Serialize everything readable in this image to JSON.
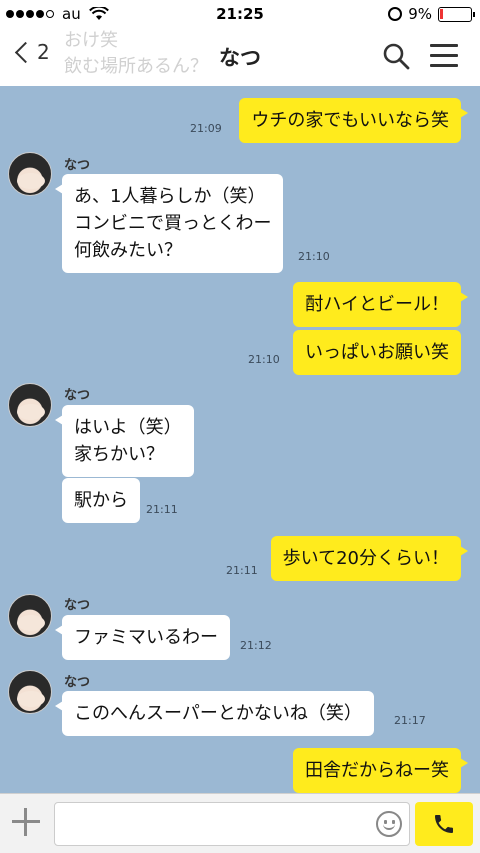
{
  "status_bar": {
    "carrier": "au",
    "time": "21:25",
    "battery": "9%",
    "battery_level": 0.09
  },
  "header": {
    "back_count": "2",
    "title": "なつ",
    "notice_preview": "おけ笑\n飲む場所あるん？"
  },
  "chat": {
    "sender_name": "なつ",
    "messages": [
      {
        "from": "me",
        "text": "ウチの家でもいいなら笑",
        "time": "21:09"
      },
      {
        "from": "them",
        "text": "あ、1人暮らしか（笑）\nコンビニで買っとくわー\n何飲みたい？",
        "time": "21:10"
      },
      {
        "from": "me",
        "text": "酎ハイとビール！"
      },
      {
        "from": "me",
        "text": "いっぱいお願い笑",
        "time": "21:10"
      },
      {
        "from": "them",
        "text": "はいよ（笑）\n家ちかい？"
      },
      {
        "from": "them",
        "text": "駅から",
        "time": "21:11"
      },
      {
        "from": "me",
        "text": "歩いて20分くらい！",
        "time": "21:11"
      },
      {
        "from": "them",
        "text": "ファミマいるわー",
        "time": "21:12"
      },
      {
        "from": "them",
        "text": "このへんスーパーとかないね（笑）",
        "time": "21:17"
      },
      {
        "from": "me",
        "text": "田舎だからねー笑"
      }
    ]
  },
  "input": {
    "placeholder": ""
  },
  "icons": {
    "back": "chevron-left-icon",
    "search": "search-icon",
    "menu": "menu-icon",
    "add": "plus-icon",
    "emoji": "emoji-icon",
    "call": "phone-icon"
  },
  "colors": {
    "background": "#9bb8d3",
    "my_bubble": "#ffeb1d",
    "their_bubble": "#ffffff"
  }
}
